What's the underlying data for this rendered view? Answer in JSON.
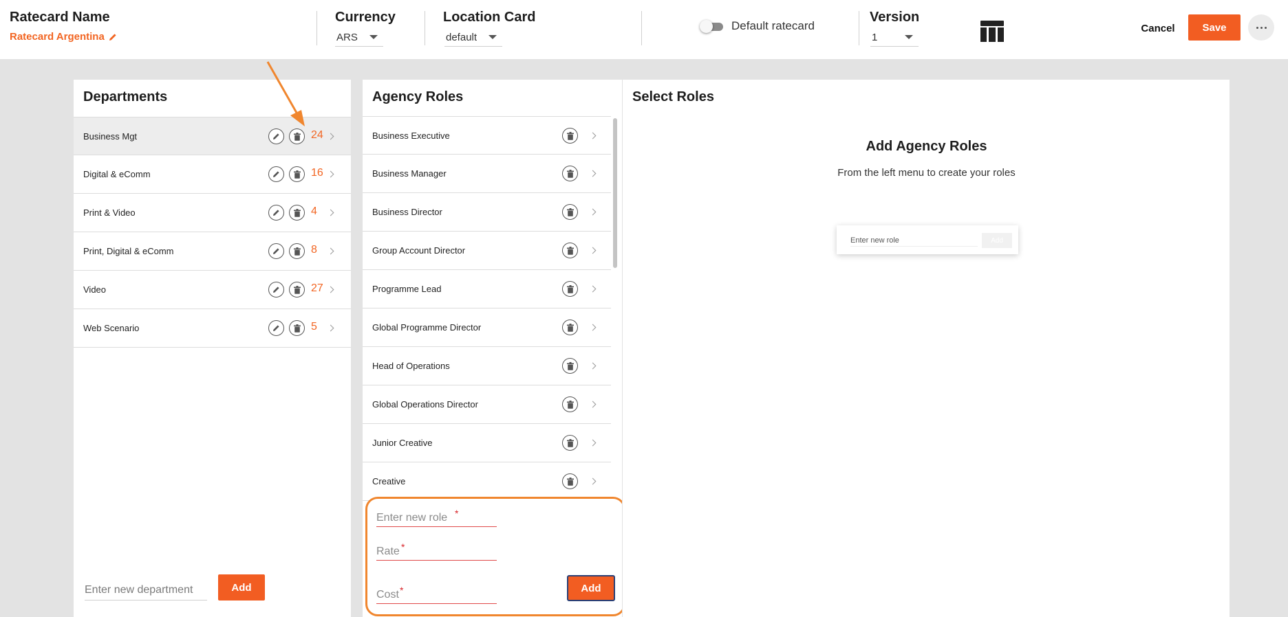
{
  "header": {
    "ratecard_name_label": "Ratecard Name",
    "ratecard_name_value": "Ratecard Argentina",
    "currency_label": "Currency",
    "currency_value": "ARS",
    "location_label": "Location Card",
    "location_value": "default",
    "default_ratecard_label": "Default ratecard",
    "default_ratecard_on": false,
    "version_label": "Version",
    "version_value": "1",
    "table_icon": "table-icon",
    "cancel_label": "Cancel",
    "save_label": "Save",
    "more_icon": "more-horizontal-icon"
  },
  "departments": {
    "title": "Departments",
    "items": [
      {
        "label": "Business Mgt",
        "count": "24",
        "selected": true
      },
      {
        "label": "Digital & eComm",
        "count": "16",
        "selected": false
      },
      {
        "label": "Print & Video",
        "count": "4",
        "selected": false
      },
      {
        "label": "Print, Digital & eComm",
        "count": "8",
        "selected": false
      },
      {
        "label": "Video",
        "count": "27",
        "selected": false
      },
      {
        "label": "Web Scenario",
        "count": "5",
        "selected": false
      }
    ],
    "new_placeholder": "Enter new department",
    "add_label": "Add"
  },
  "agency_roles": {
    "title": "Agency Roles",
    "items": [
      "Business Executive",
      "Business Manager",
      "Business Director",
      "Group Account Director",
      "Programme Lead",
      "Global Programme Director",
      "Head of Operations",
      "Global Operations Director",
      "Junior Creative",
      "Creative"
    ],
    "form": {
      "role_placeholder": "Enter new role",
      "rate_placeholder": "Rate",
      "cost_placeholder": "Cost",
      "required_mark": "*",
      "add_label": "Add"
    }
  },
  "select_roles": {
    "title": "Select Roles",
    "empty_title": "Add Agency Roles",
    "empty_subtitle": "From the left menu to create your roles",
    "mini_placeholder": "Enter new role",
    "mini_add_label": "Add"
  },
  "colors": {
    "accent": "#f25d22",
    "count_text": "#f26522",
    "annotation": "#f0862e",
    "required": "#d8262a",
    "background": "#e3e3e3"
  }
}
